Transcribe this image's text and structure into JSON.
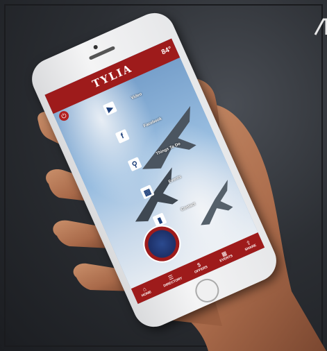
{
  "app": {
    "title": "TYLIA",
    "temperature": "84°"
  },
  "menu": [
    {
      "icon": "video-icon",
      "glyph": "▶",
      "label": "Video"
    },
    {
      "icon": "facebook-icon",
      "glyph": "f",
      "label": "Facebook"
    },
    {
      "icon": "runner-icon",
      "glyph": "⚲",
      "label": "Things To Do"
    },
    {
      "icon": "calendar-icon",
      "glyph": "▦",
      "label": "Events"
    },
    {
      "icon": "phone-icon",
      "glyph": "▮",
      "label": "Contact"
    }
  ],
  "tabbar": {
    "items": [
      {
        "icon": "home-icon",
        "glyph": "⌂",
        "label": "HOME"
      },
      {
        "icon": "directory-icon",
        "glyph": "☰",
        "label": "DIRECTORY"
      },
      {
        "icon": "offers-icon",
        "glyph": "$",
        "label": "OFFERS"
      },
      {
        "icon": "events-icon",
        "glyph": "▦",
        "label": "EVENTS"
      },
      {
        "icon": "share-icon",
        "glyph": "⇪",
        "label": "SHARE"
      }
    ]
  },
  "colors": {
    "brand_red": "#9e1b1b",
    "background": "#2c2f34"
  }
}
